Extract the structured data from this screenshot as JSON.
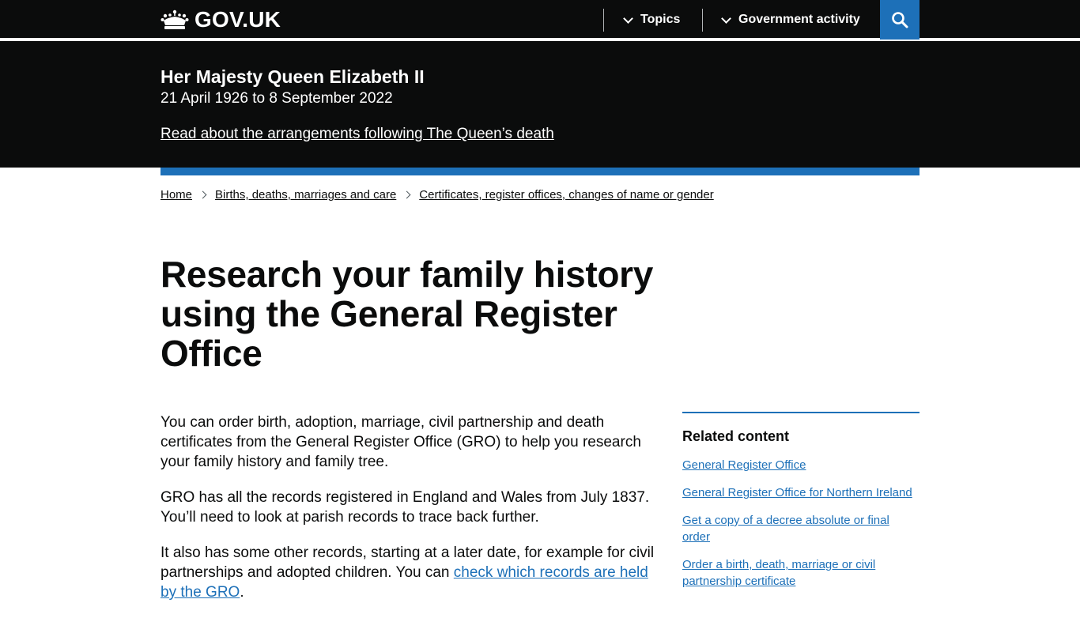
{
  "header": {
    "logo_text": "GOV.UK",
    "nav": {
      "topics": "Topics",
      "government_activity": "Government activity"
    }
  },
  "banner": {
    "title": "Her Majesty Queen Elizabeth II",
    "dates": "21 April 1926 to 8 September 2022",
    "link": "Read about the arrangements following The Queen’s death"
  },
  "breadcrumbs": [
    "Home",
    "Births, deaths, marriages and care",
    "Certificates, register offices, changes of name or gender"
  ],
  "page": {
    "title": "Research your family history using the General Register Office",
    "paragraphs": [
      "You can order birth, adoption, marriage, civil partnership and death certificates from the General Register Office (GRO) to help you research your family history and family tree.",
      "GRO has all the records registered in England and Wales from July 1837. You’ll need to look at parish records to trace back further."
    ],
    "para3_text": "It also has some other records, starting at a later date, for example for civil partnerships and adopted children. You can ",
    "para3_link": "check which records are held by the GRO",
    "para3_end": "."
  },
  "related": {
    "heading": "Related content",
    "links": [
      "General Register Office",
      "General Register Office for Northern Ireland",
      "Get a copy of a decree absolute or final order",
      "Order a birth, death, marriage or civil partnership certificate"
    ]
  },
  "colors": {
    "header_bg": "#0b0c0c",
    "brand_blue": "#1d70b8",
    "text": "#0b0c0c"
  },
  "icons": {
    "logo": "crown-icon",
    "search": "search-icon",
    "chevron": "chevron-down-icon"
  }
}
